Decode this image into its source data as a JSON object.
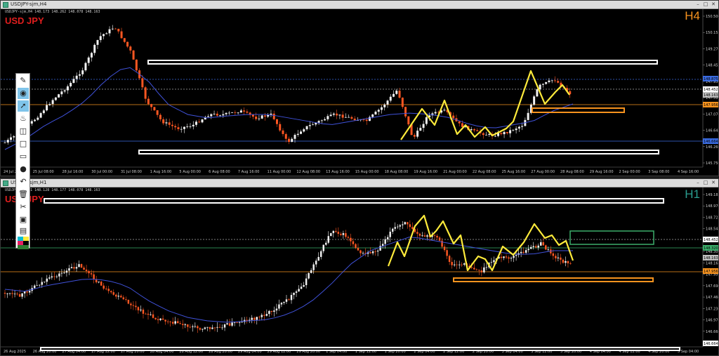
{
  "windows": [
    {
      "title": "USDJPY-sjm,H4",
      "info": "USDJPY-sjm,H4  148.173 148.262 148.078 148.163",
      "symbol": "USD JPY",
      "timeframe": "H4",
      "timeframe_color": "#f7931e",
      "price_labels": [
        "150.500",
        "150.155",
        "149.270",
        "148.452",
        "147.956",
        "147.510",
        "147.070",
        "146.645",
        "146.260",
        "145.750"
      ],
      "tag_labels": [
        "148.875",
        "148.452",
        "148.163",
        "147.956",
        "146.664"
      ],
      "time_labels": [
        "24 Jul 2025",
        "25 Jul 08:00",
        "28 Jul 16:00",
        "30 Jul 00:00",
        "31 Jul 08:00",
        "1 Aug 16:00",
        "5 Aug 00:00",
        "6 Aug 08:00",
        "7 Aug 16:00",
        "11 Aug 00:00",
        "12 Aug 08:00",
        "13 Aug 16:00",
        "15 Aug 00:00",
        "18 Aug 08:00",
        "19 Aug 16:00",
        "21 Aug 00:00",
        "22 Aug 08:00",
        "25 Aug 16:00",
        "27 Aug 00:00",
        "28 Aug 08:00",
        "29 Aug 16:00",
        "2 Sep 00:00",
        "3 Sep 08:00",
        "4 Sep 16:00"
      ]
    },
    {
      "title": "USDJPY-sjm,H1",
      "info": "USDJPY-sjm,H1  148.128 148.177 148.078 148.163",
      "symbol": "USD JPY",
      "timeframe": "H1",
      "timeframe_color": "#2a9d8f",
      "price_labels": [
        "149.185",
        "148.970",
        "148.725",
        "148.545",
        "148.452",
        "148.300",
        "148.163",
        "147.956",
        "147.690",
        "147.460",
        "147.230",
        "146.970",
        "146.664",
        "146.505"
      ],
      "tag_labels": [
        "148.452",
        "148.320",
        "148.163",
        "147.956",
        "146.664"
      ],
      "time_labels": [
        "26 Aug 2025",
        "26 Aug 20:00",
        "27 Aug 04:00",
        "27 Aug 12:00",
        "27 Aug 20:00",
        "28 Aug 04:00",
        "28 Aug 12:00",
        "28 Aug 20:00",
        "29 Aug 04:00",
        "29 Aug 12:00",
        "29 Aug 20:00",
        "1 Sep 04:00",
        "1 Sep 12:00",
        "1 Sep 20:00",
        "2 Sep 04:00",
        "2 Sep 12:00",
        "2 Sep 20:00",
        "3 Sep 04:00",
        "3 Sep 12:00",
        "3 Sep 20:00",
        "4 Sep 04:00",
        "4 Sep 12:00",
        "4 Sep 20:00",
        "5 Sep 04:00"
      ]
    }
  ],
  "toolbar": {
    "tools": [
      "pen-icon",
      "eye-icon",
      "cursor-icon",
      "bell-icon",
      "tag-icon",
      "rectangle-icon",
      "eraser-icon",
      "dot-icon",
      "undo-icon",
      "trash-icon",
      "clip-icon",
      "camera-icon",
      "clipboard-icon",
      "palette-icon"
    ],
    "colors": [
      "#00bcd4",
      "#ffeb3b",
      "#e91e63",
      "#000000",
      "#2e7d32"
    ]
  }
}
